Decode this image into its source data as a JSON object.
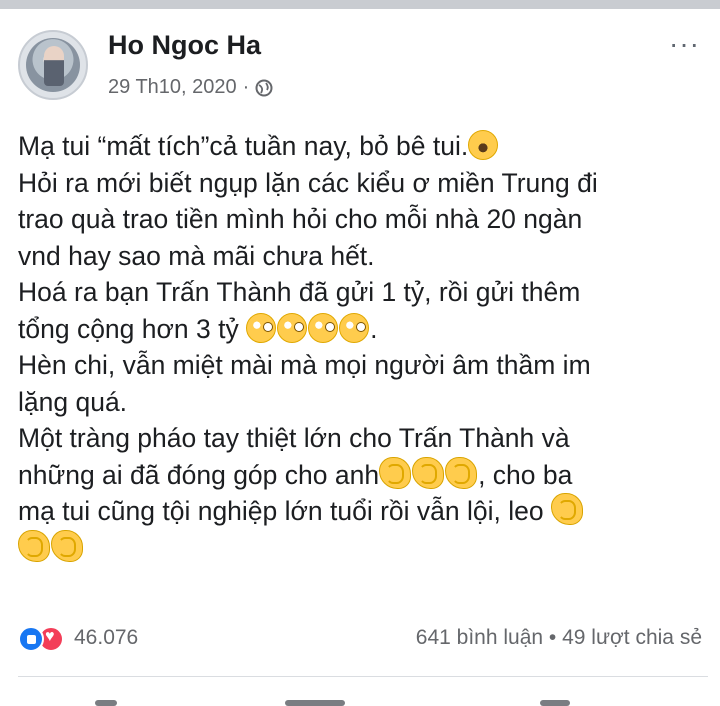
{
  "post": {
    "author": "Ho Ngoc Ha",
    "timestamp": "29 Th10, 2020",
    "separator": "·",
    "more_label": "···",
    "lines": [
      "Mạ tui “mất tích”cả tuần nay, bỏ bê tui.",
      "Hỏi ra mới biết ngụp lặn các kiểu ơ miền Trung đi",
      "trao quà trao tiền mình hỏi cho mỗi nhà 20 ngàn",
      "vnd hay sao mà mãi chưa hết.",
      "Hoá ra bạn Trấn Thành đã gửi 1 tỷ, rồi gửi thêm",
      "tổng cộng hơn 3 tỷ",
      ".",
      "Hèn chi, vẫn miệt mài mà mọi người âm thầm im",
      "lặng quá.",
      "Một tràng pháo tay thiệt lớn cho Trấn Thành và",
      "những ai đã đóng góp cho anh",
      ", cho ba",
      "mạ tui cũng tội nghiệp lớn tuổi rồi vẫn lội, leo"
    ]
  },
  "footer": {
    "reaction_count": "46.076",
    "stats": "641 bình luận • 49 lượt chia sẻ"
  },
  "icons": {
    "privacy": "globe-icon",
    "reactions": [
      "like-icon",
      "love-icon"
    ],
    "emojis": [
      "laughing-emoji",
      "flushed-emoji",
      "clapping-emoji"
    ]
  },
  "colors": {
    "like": "#1877f2",
    "love": "#f33e58",
    "meta_text": "#65676b"
  }
}
